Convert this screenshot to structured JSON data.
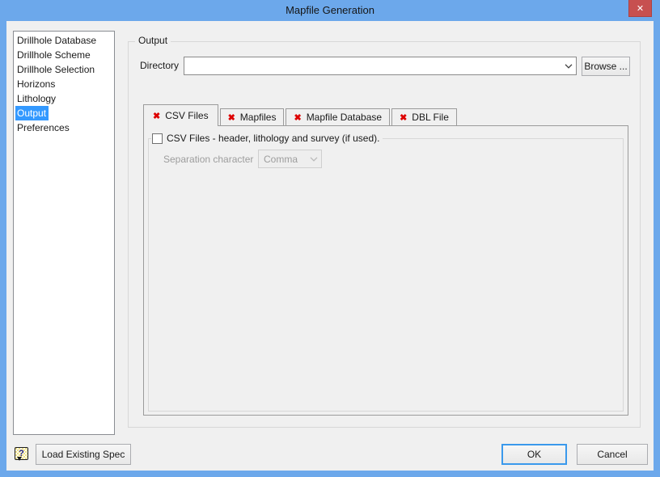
{
  "window": {
    "title": "Mapfile Generation"
  },
  "icons": {
    "close_glyph": "✕",
    "tab_error_glyph": "✖",
    "help_glyph": "?",
    "combo_arrow": "chevron-down"
  },
  "colors": {
    "titlebar_blue": "#6ca8eb",
    "close_button_red": "#c75050",
    "selection_blue": "#3399ff",
    "tab_error_red": "#dd0000",
    "default_button_border_blue": "#3a99ec",
    "dialog_bg": "#f0f0f0"
  },
  "sidebar": {
    "items": [
      {
        "label": "Drillhole Database",
        "selected": false
      },
      {
        "label": "Drillhole Scheme",
        "selected": false
      },
      {
        "label": "Drillhole Selection",
        "selected": false
      },
      {
        "label": "Horizons",
        "selected": false
      },
      {
        "label": "Lithology",
        "selected": false
      },
      {
        "label": "Output",
        "selected": true
      },
      {
        "label": "Preferences",
        "selected": false
      }
    ]
  },
  "output_panel": {
    "group_title": "Output",
    "directory_label": "Directory",
    "directory_value": "",
    "browse_label": "Browse ...",
    "tabs": [
      {
        "label": "CSV Files",
        "active": true,
        "status": "error"
      },
      {
        "label": "Mapfiles",
        "active": false,
        "status": "error"
      },
      {
        "label": "Mapfile Database",
        "active": false,
        "status": "error"
      },
      {
        "label": "DBL File",
        "active": false,
        "status": "error"
      }
    ],
    "csv_tab": {
      "checkbox_label": "CSV Files - header, lithology and survey (if used).",
      "checkbox_checked": false,
      "separation_label": "Separation character",
      "separation_value": "Comma",
      "separation_enabled": false
    }
  },
  "footer": {
    "load_spec_label": "Load Existing Spec",
    "ok_label": "OK",
    "cancel_label": "Cancel"
  }
}
